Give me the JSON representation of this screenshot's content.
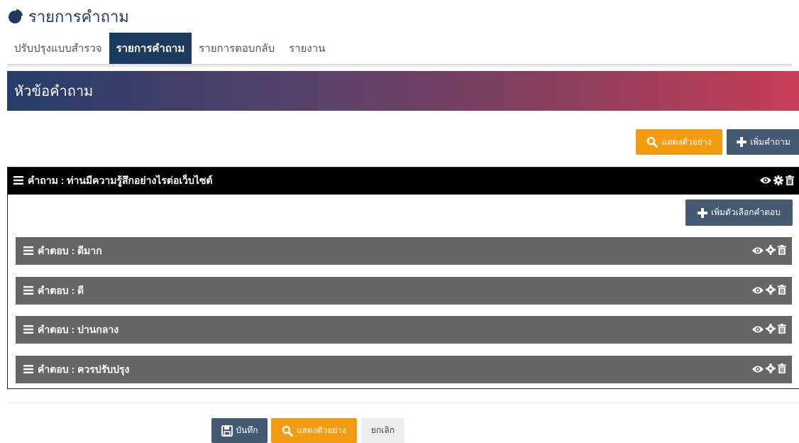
{
  "header": {
    "title": "รายการคำถาม",
    "icon": "pie-chart-icon"
  },
  "tabs": [
    {
      "label": "ปรับปรุงแบบสำรวจ",
      "active": false
    },
    {
      "label": "รายการคำถาม",
      "active": true
    },
    {
      "label": "รายการตอบกลับ",
      "active": false
    },
    {
      "label": "รายงาน",
      "active": false
    }
  ],
  "section": {
    "title": "หัวข้อคำถาม"
  },
  "toolbar": {
    "preview_label": "แสดงตัวอย่าง",
    "add_question_label": "เพิ่มคำถาม"
  },
  "question": {
    "text": "คำถาม : ท่านมีความรู้สึกอย่างไรต่อเว็บไซต์",
    "add_option_label": "เพิ่มตัวเลือกคำตอบ",
    "answers": [
      {
        "text": "คำตอบ : ดีมาก"
      },
      {
        "text": "คำตอบ : ดี"
      },
      {
        "text": "คำตอบ : ปานกลาง"
      },
      {
        "text": "คำตอบ : ควรปรับปรุง"
      }
    ]
  },
  "footer": {
    "save_label": "บันทึก",
    "preview_label": "แสดงตัวอย่าง",
    "cancel_label": "ยกเลิก"
  },
  "colors": {
    "primary": "#1d3b5e",
    "orange": "#f39c12",
    "slate": "#435a72",
    "answer_bg": "#666666"
  }
}
